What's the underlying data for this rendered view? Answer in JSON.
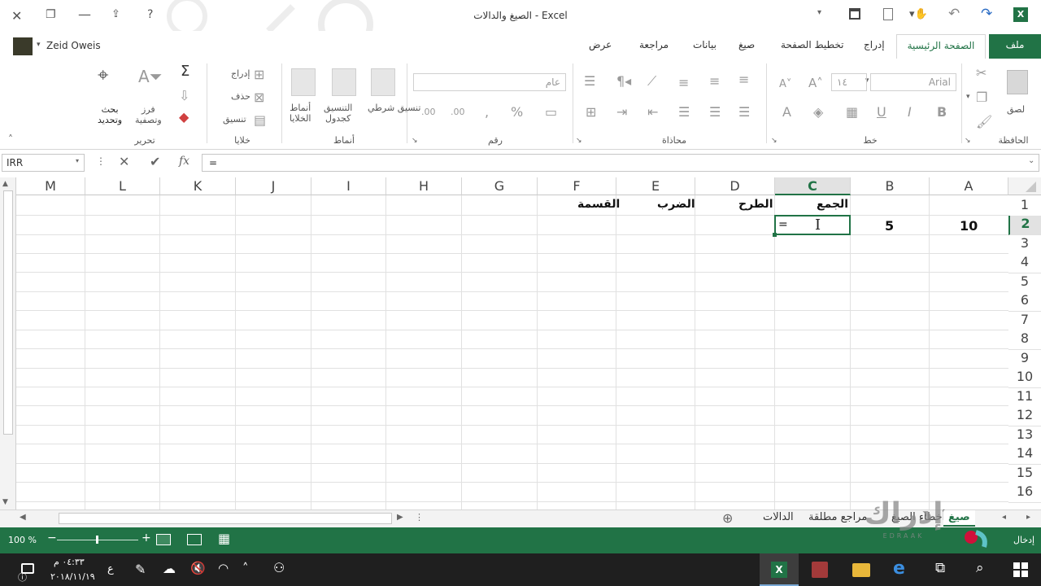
{
  "window": {
    "title": "الصيغ والدالات - Excel",
    "user": "Zeid Oweis"
  },
  "ribbon_tabs": [
    "ملف",
    "الصفحة الرئيسية",
    "إدراج",
    "تخطيط الصفحة",
    "صيغ",
    "بيانات",
    "مراجعة",
    "عرض"
  ],
  "ribbon": {
    "clipboard": {
      "group": "الحافظة",
      "paste": "لصق"
    },
    "font": {
      "group": "خط",
      "name": "Arial",
      "size": "١٤"
    },
    "alignment": {
      "group": "محاذاة"
    },
    "number": {
      "group": "رقم",
      "format": "عام"
    },
    "styles": {
      "group": "أنماط",
      "conditional": "تنسيق شرطي",
      "table_1": "التنسيق",
      "table_2": "كجدول",
      "cell_1": "أنماط",
      "cell_2": "الخلايا"
    },
    "cells": {
      "group": "خلايا",
      "insert": "إدراج",
      "delete": "حذف",
      "format": "تنسيق"
    },
    "editing": {
      "group": "تحرير",
      "sort_1": "فرز",
      "sort_2": "وتصفية",
      "find_1": "بحث",
      "find_2": "وتحديد"
    }
  },
  "formula_bar": {
    "name_box": "IRR",
    "formula": "=",
    "fx": "fx"
  },
  "columns": [
    "A",
    "B",
    "C",
    "D",
    "E",
    "F",
    "G",
    "H",
    "I",
    "J",
    "K",
    "L",
    "M"
  ],
  "rows": [
    "1",
    "2",
    "3",
    "4",
    "5",
    "6",
    "7",
    "8",
    "9",
    "10",
    "11",
    "12",
    "13",
    "14",
    "15",
    "16"
  ],
  "cells": {
    "A2": "10",
    "B2": "5",
    "C1": "الجمع",
    "C2": "=",
    "D1": "الطرح",
    "E1": "الضرب",
    "F1": "القسمة"
  },
  "sheet_tabs": [
    "صيغ",
    "أخطاء الصيغ",
    "مراجع مطلقة",
    "الدالات"
  ],
  "status": {
    "mode": "إدخال",
    "zoom": "100 %"
  },
  "taskbar": {
    "time": "٠٤:٣٣ م",
    "date": "٢٠١٨/١١/١٩",
    "lang": "ع"
  },
  "watermark": {
    "text": "إدراك",
    "sub": "EDRAAK"
  },
  "colors": {
    "excel_green": "#217346",
    "selection": "#217346",
    "taskbar": "#1f1f1f"
  }
}
